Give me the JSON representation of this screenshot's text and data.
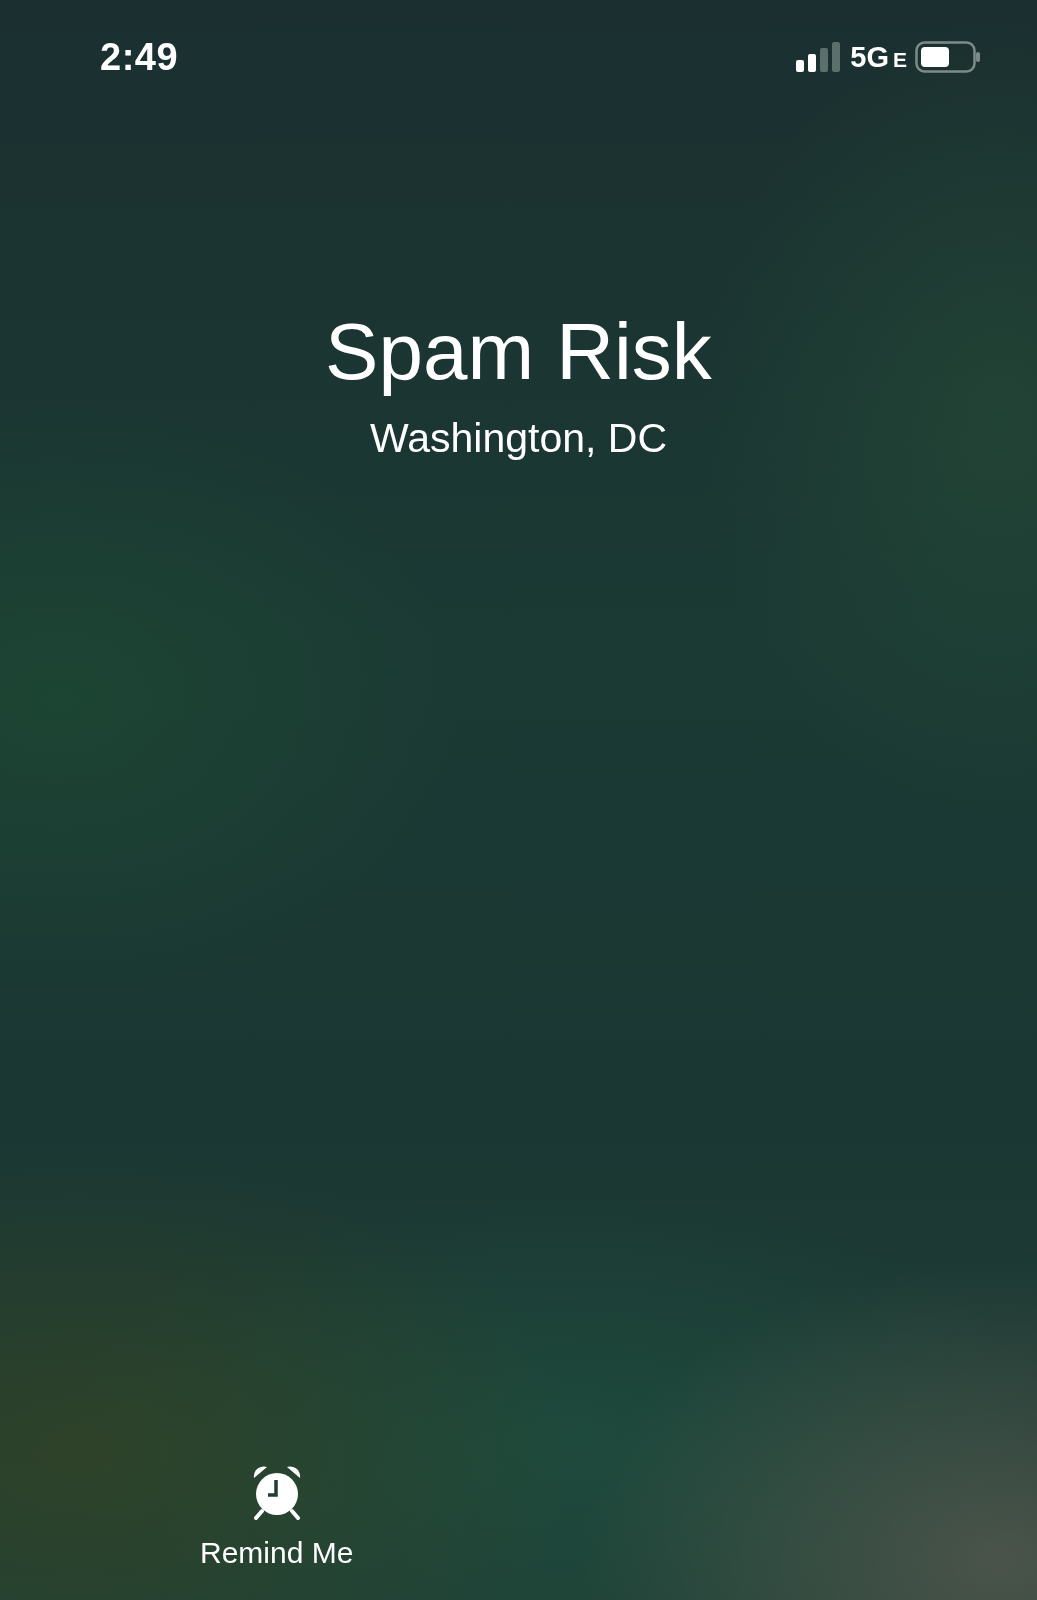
{
  "status_bar": {
    "time": "2:49",
    "network": "5G",
    "network_suffix": "E"
  },
  "caller": {
    "name": "Spam Risk",
    "location": "Washington, DC"
  },
  "actions": [
    {
      "kind": "remind",
      "label": "Remind Me"
    }
  ]
}
